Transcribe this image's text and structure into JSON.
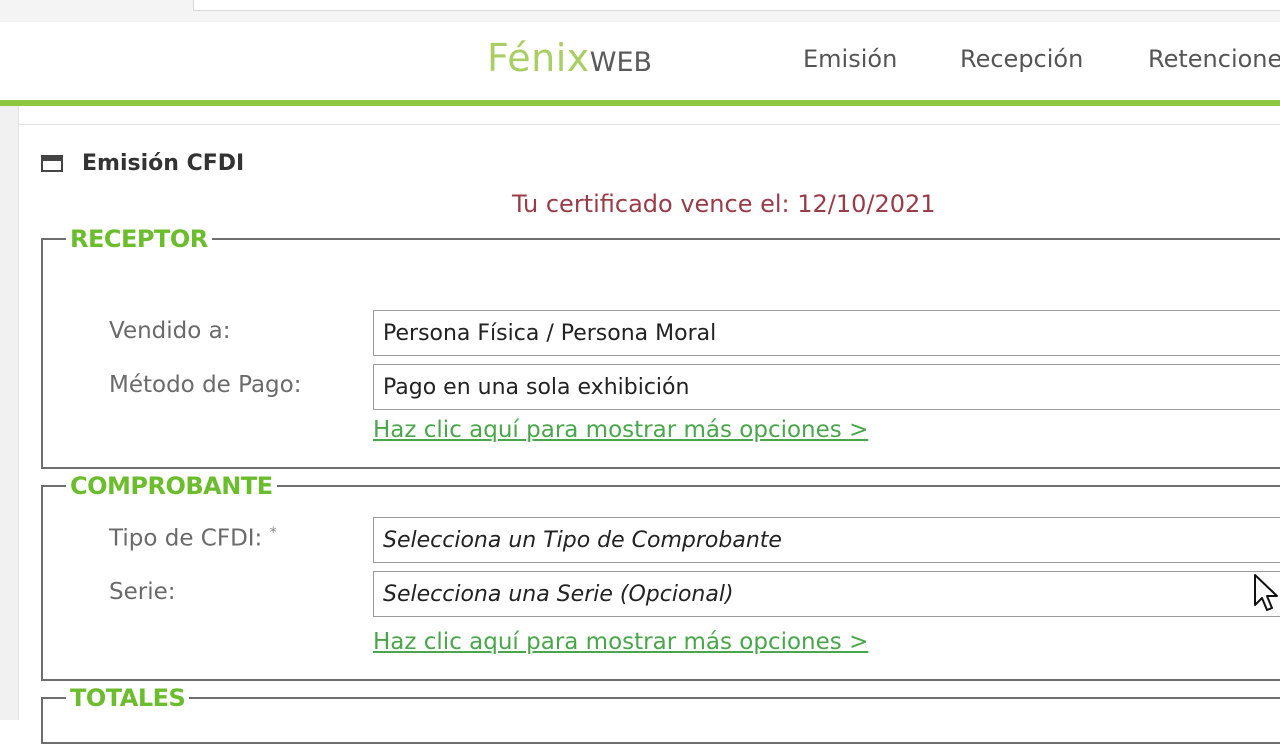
{
  "header": {
    "logo_main": "Fénix",
    "logo_sub": "WEB",
    "nav": [
      {
        "label": "Emisión"
      },
      {
        "label": "Recepción"
      },
      {
        "label": "Retenciones"
      }
    ]
  },
  "panel": {
    "title": "Emisión CFDI",
    "cert_notice": "Tu certificado vence el: 12/10/2021"
  },
  "receptor": {
    "legend": "RECEPTOR",
    "vendido_label": "Vendido a:",
    "vendido_value": "Persona Física / Persona Moral",
    "metodo_label": "Método de Pago:",
    "metodo_value": "Pago en una sola exhibición",
    "more_link": "Haz clic aquí para mostrar más opciones >"
  },
  "comprobante": {
    "legend": "COMPROBANTE",
    "tipo_label": "Tipo de CFDI:",
    "tipo_required_mark": "*",
    "tipo_value": "Selecciona un Tipo de Comprobante",
    "serie_label": "Serie:",
    "serie_value": "Selecciona una Serie (Opcional)",
    "more_link": "Haz clic aquí para mostrar más opciones >"
  },
  "totales": {
    "legend": "TOTALES"
  },
  "colors": {
    "accent_green": "#8dc63f",
    "legend_green": "#6cbd2e",
    "link_green": "#4aa64a",
    "notice_red": "#9a3b48"
  },
  "icons": {
    "panel_icon": "window-icon",
    "pointer": "mouse-cursor-icon"
  }
}
